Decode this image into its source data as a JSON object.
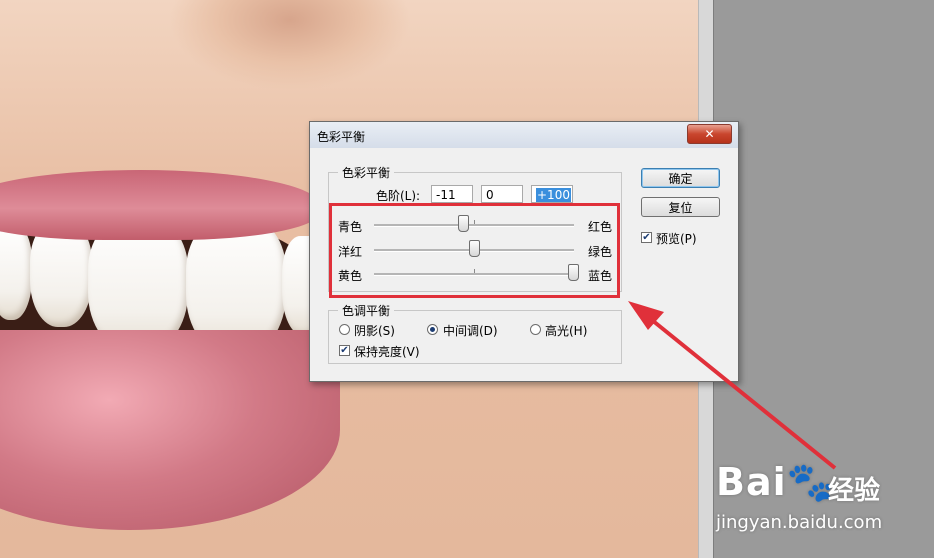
{
  "dialog": {
    "title": "色彩平衡",
    "close_label": "✕",
    "color_balance": {
      "legend": "色彩平衡",
      "levels_label": "色阶(L):",
      "levels": [
        "-11",
        "0",
        "+100"
      ],
      "sliders": [
        {
          "left": "青色",
          "right": "红色",
          "value": -11
        },
        {
          "left": "洋红",
          "right": "绿色",
          "value": 0
        },
        {
          "left": "黄色",
          "right": "蓝色",
          "value": 100
        }
      ]
    },
    "tone_balance": {
      "legend": "色调平衡",
      "options": [
        "阴影(S)",
        "中间调(D)",
        "高光(H)"
      ],
      "selected": "中间调(D)",
      "preserve_luminosity": "保持亮度(V)",
      "preserve_checked": true
    },
    "buttons": {
      "ok": "确定",
      "reset": "复位"
    },
    "preview": {
      "label": "预览(P)",
      "checked": true
    }
  },
  "watermark": {
    "logo": "Bai🐾经验",
    "logo_left": "Bai",
    "logo_right": "经验",
    "url": "jingyan.baidu.com"
  },
  "colors": {
    "highlight": "#e0303a",
    "selection": "#3a8fdd"
  }
}
